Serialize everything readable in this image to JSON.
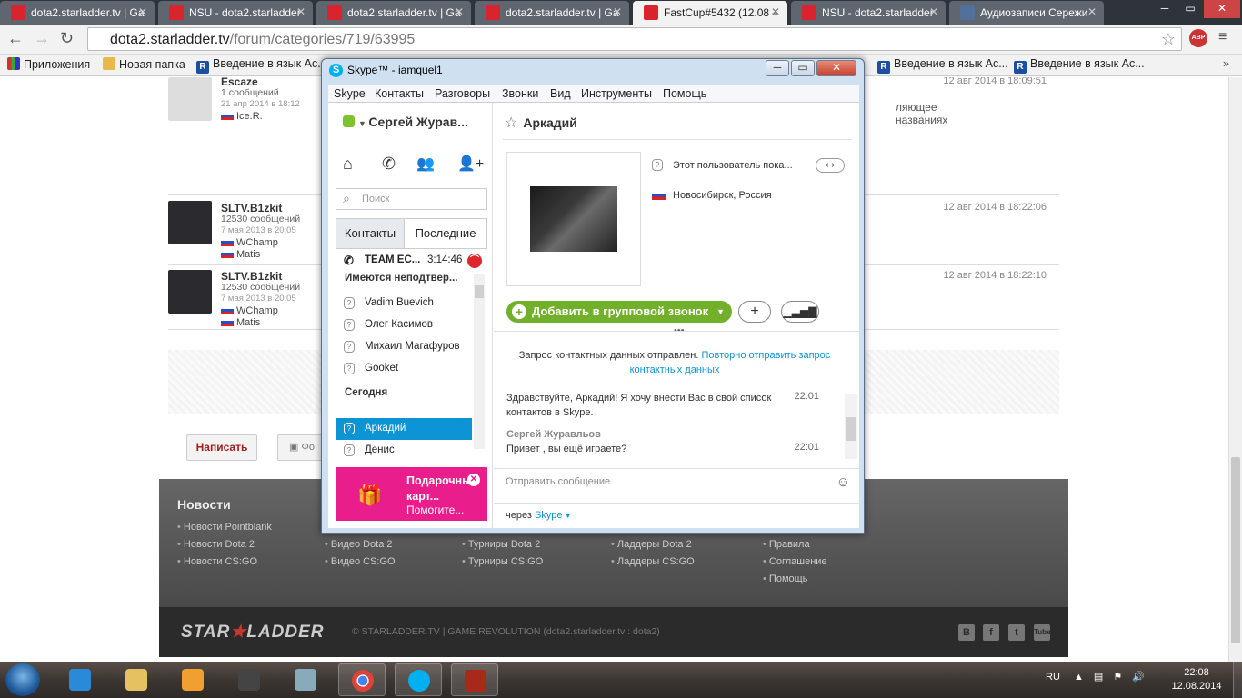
{
  "browser": {
    "tabs": [
      {
        "label": "dota2.starladder.tv | Ga",
        "icon": "starladder-favicon"
      },
      {
        "label": "NSU - dota2.starladder",
        "icon": "starladder-favicon"
      },
      {
        "label": "dota2.starladder.tv | Ga",
        "icon": "starladder-favicon"
      },
      {
        "label": "dota2.starladder.tv | Ga",
        "icon": "starladder-favicon"
      },
      {
        "label": "FastCup#5432 (12.08 –",
        "icon": "starladder-favicon"
      },
      {
        "label": "NSU - dota2.starladder",
        "icon": "starladder-favicon"
      },
      {
        "label": "Аудиозаписи Сережи",
        "icon": "vk-favicon"
      }
    ],
    "active_tab_index": 4,
    "url_host": "dota2.starladder.tv",
    "url_path": "/forum/categories/719/63995",
    "extension_badge": "ABP",
    "bookmarks": [
      {
        "label": "Приложения",
        "icon": "apps-icon"
      },
      {
        "label": "Новая папка",
        "icon": "folder-icon"
      },
      {
        "label": "Введение в язык Ас...",
        "icon": "r-favicon"
      },
      {
        "label": "Введение в язык Ас...",
        "icon": "r-favicon"
      },
      {
        "label": "Введение в язык Ас...",
        "icon": "r-favicon"
      }
    ]
  },
  "forum": {
    "posts": [
      {
        "name": "Escaze",
        "count": "1 сообщений",
        "date": "21 апр 2014 в 18:12",
        "flags": [
          "Ice.R."
        ],
        "time": "12 авг 2014 в 18:09:51",
        "text1": "ляющее",
        "text2": "названиях"
      },
      {
        "name": "SLTV.B1zkit",
        "count": "12530 сообщений",
        "date": "7 мая 2013 в 20:05",
        "flags": [
          "WChamp",
          "Matis"
        ],
        "time": "12 авг 2014 в 18:22:06"
      },
      {
        "name": "SLTV.B1zkit",
        "count": "12530 сообщений",
        "date": "7 мая 2013 в 20:05",
        "flags": [
          "WChamp",
          "Matis"
        ],
        "time": "12 авг 2014 в 18:22:10"
      }
    ],
    "reply_button": "Написать",
    "photo_button": "Фо"
  },
  "footer": {
    "news_title": "Новости",
    "columns": [
      [
        "Новости Pointblank",
        "Новости Dota 2",
        "Новости CS:GO"
      ],
      [
        "Видео Dota 2",
        "Видео CS:GO"
      ],
      [
        "Турниры Dota 2",
        "Турниры CS:GO"
      ],
      [
        "Ладдеры Dota 2",
        "Ладдеры CS:GO"
      ],
      [
        "Правила",
        "Соглашение",
        "Помощь"
      ]
    ],
    "logo_a": "STAR",
    "logo_b": "LADDER",
    "copyright": "© STARLADDER.TV | GAME REVOLUTION (dota2.starladder.tv : dota2)",
    "social": [
      "В",
      "f",
      "t",
      "Tube"
    ]
  },
  "skype": {
    "title": "Skype™ - iamquel1",
    "menu": [
      "Skype",
      "Контакты",
      "Разговоры",
      "Звонки",
      "Вид",
      "Инструменты",
      "Помощь"
    ],
    "user_name": "Сергей Журав...",
    "search_placeholder": "Поиск",
    "tab_contacts": "Контакты",
    "tab_recent": "Последние",
    "call_entry": {
      "name": "TEAM EC...",
      "time": "3:14:46"
    },
    "pending_header": "Имеются неподтвер...",
    "pending": [
      "Vadim Buevich",
      "Олег Касимов",
      "Михаил Магафуров",
      "Gooket"
    ],
    "today_header": "Сегодня",
    "today": [
      "Аркадий",
      "Денис"
    ],
    "ad": {
      "title": "Подарочные карт...",
      "more": "Помогите..."
    },
    "contact_name": "Аркадий",
    "mood": "Этот пользователь пока...",
    "location": "Новосибирск, Россия",
    "add_call_button": "Добавить в групповой звонок",
    "request_text": "Запрос контактных данных отправлен.",
    "resend_link": "Повторно отправить запрос контактных данных",
    "messages": [
      {
        "text": "Здравствуйте, Аркадий! Я хочу внести Вас в свой список контактов в Skype.",
        "time": "22:01"
      },
      {
        "author": "Сергей Журавльов",
        "text": "Привет , вы ещё играете?",
        "time": "22:01"
      }
    ],
    "compose_placeholder": "Отправить сообщение",
    "via_label": "через",
    "via_service": "Skype"
  },
  "taskbar": {
    "lang": "RU",
    "time": "22:08",
    "date": "12.08.2014"
  }
}
